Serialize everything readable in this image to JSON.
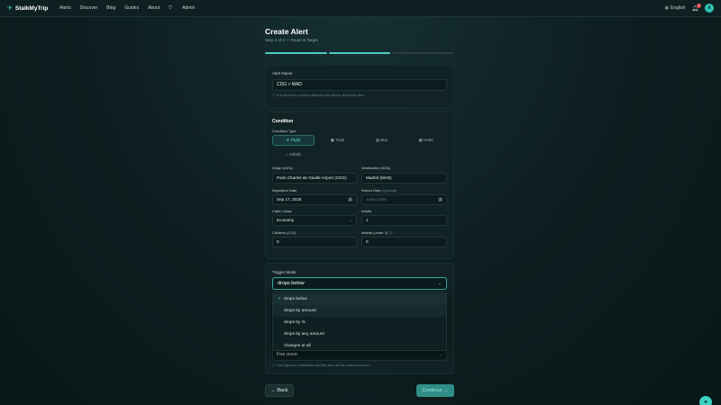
{
  "nav": {
    "brand": "StalkMyTrip",
    "links": [
      "Alerts",
      "Discover",
      "Blog",
      "Guides",
      "About"
    ],
    "admin": "Admin",
    "language": "English",
    "notification_count": "1",
    "avatar_initial": "A"
  },
  "header": {
    "title": "Create Alert",
    "subtitle": "Step 2 of 3 — Route & Target"
  },
  "progress": {
    "steps_total": 3,
    "steps_done": 2
  },
  "alert_name": {
    "label": "Alert Name",
    "value": "CDG > MAD",
    "hint": "If it has been a sent a category this alert to show this alert"
  },
  "condition": {
    "section_label": "Condition",
    "type_label": "Condition Type",
    "types": [
      "Flight",
      "Train",
      "Bus",
      "Hotel",
      "Airbnb"
    ],
    "active_type": "Flight",
    "origin_label": "Origin (IATA)",
    "origin_value": "Paris Charles de Gaulle Airport (CDG)",
    "destination_label": "Destination (IATA)",
    "destination_value": "Madrid (MAD)",
    "departure_label": "Departure Date",
    "departure_value": "Sep 17, 2025",
    "return_label": "Return Date",
    "return_optional": "(optional)",
    "return_placeholder": "Select date",
    "cabin_label": "Cabin Class",
    "cabin_value": "Economy",
    "adults_label": "Adults",
    "adults_value": "1",
    "children_label": "Children (2-11)",
    "children_value": "0",
    "infants_label": "Infants (under 2)",
    "infants_value": "0"
  },
  "trigger": {
    "label": "Trigger Mode",
    "selected": "drops below",
    "options": [
      "drops below",
      "drops by amount",
      "drops by %",
      "drops by any amount",
      "changes at all"
    ]
  },
  "fire": {
    "value": "Fire once",
    "hint": "You'll get one notification and the alert will be marked as fired"
  },
  "actions": {
    "back": "Back",
    "continue": "Continue"
  }
}
